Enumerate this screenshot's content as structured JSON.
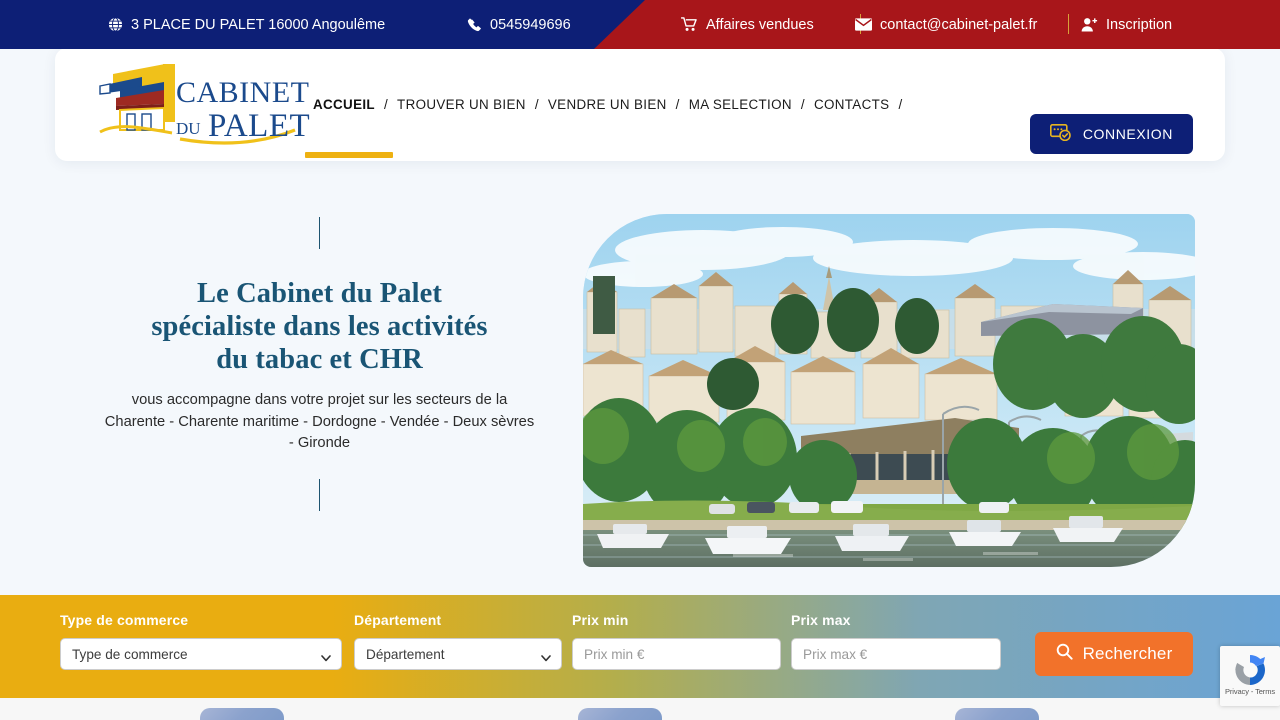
{
  "topbar": {
    "address": "3 PLACE DU PALET 16000 Angoulême",
    "address_icon": "globe-icon",
    "phone": "0545949696",
    "phone_icon": "phone-icon",
    "sold": "Affaires vendues",
    "sold_icon": "cart-icon",
    "email": "contact@cabinet-palet.fr",
    "email_icon": "envelope-icon",
    "signup": "Inscription",
    "signup_icon": "user-plus-icon",
    "bg_navy": "#0d1f76",
    "bg_red": "#a8161a",
    "separator_color": "#d8a23a"
  },
  "header": {
    "logo": {
      "name": "cabinet-du-palet-logo",
      "line1": "CABINET",
      "line2_small": "DU",
      "line2": "PALET",
      "gold": "#f0c11a",
      "navy": "#1b4a8c",
      "red": "#9e2a22"
    },
    "nav": [
      {
        "label": "ACCUEIL",
        "active": true
      },
      {
        "label": "TROUVER UN BIEN",
        "active": false
      },
      {
        "label": "VENDRE UN BIEN",
        "active": false
      },
      {
        "label": "MA SELECTION",
        "active": false
      },
      {
        "label": "CONTACTS",
        "active": false
      }
    ],
    "nav_separator": "/",
    "active_underline_color": "#eeb111",
    "connexion": {
      "label": "CONNEXION",
      "icon": "login-card-check-icon",
      "bg": "#0d1f76",
      "icon_color": "#e6b422"
    }
  },
  "hero": {
    "heading_line1": "Le Cabinet du Palet",
    "heading_line2": "spécialiste dans les activités",
    "heading_line3": "du tabac et CHR",
    "heading_color": "#1a5575",
    "paragraph_line1": "vous accompagne dans votre projet sur les secteurs de la",
    "paragraph_line2": "Charente - Charente maritime - Dordogne - Vendée - Deux sèvres",
    "paragraph_line3": "- Gironde",
    "image_alt": "Vue panoramique d'Angoulême depuis la Charente"
  },
  "search": {
    "fields": [
      {
        "label": "Type de commerce",
        "value": "Type de commerce",
        "placeholder": "Type de commerce",
        "kind": "select"
      },
      {
        "label": "Département",
        "value": "Département",
        "placeholder": "Département",
        "kind": "select"
      },
      {
        "label": "Prix min",
        "value": "",
        "placeholder": "Prix min €",
        "kind": "input"
      },
      {
        "label": "Prix max",
        "value": "",
        "placeholder": "Prix max €",
        "kind": "input"
      }
    ],
    "submit_label": "Rechercher",
    "submit_icon": "search-icon",
    "submit_bg": "#f2722a",
    "gradient_start": "#e9ad11",
    "gradient_end": "#6aa4d6"
  },
  "recaptcha": {
    "privacy_terms": "Privacy - Terms",
    "icon": "recaptcha-logo-icon"
  }
}
